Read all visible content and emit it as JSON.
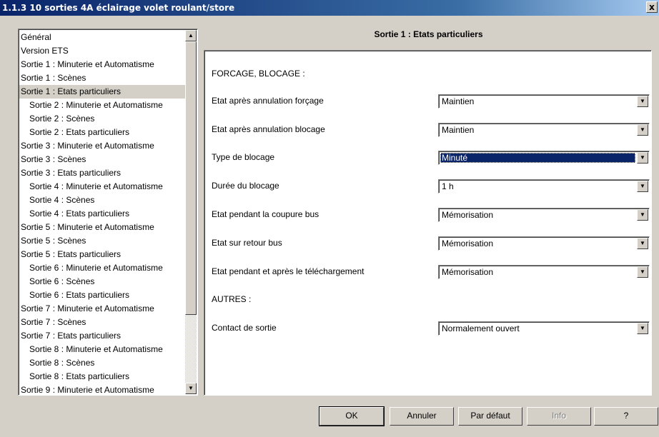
{
  "window": {
    "title": "1.1.3 10 sorties 4A éclairage volet roulant/store",
    "close_label": "x"
  },
  "tree": {
    "items": [
      {
        "label": "Général",
        "level": 1
      },
      {
        "label": "Version ETS",
        "level": 1
      },
      {
        "label": "Sortie 1 : Minuterie et Automatisme",
        "level": 1
      },
      {
        "label": "Sortie 1 : Scènes",
        "level": 1
      },
      {
        "label": "Sortie 1 : Etats particuliers",
        "level": 1,
        "selected": true
      },
      {
        "label": "Sortie 2 : Minuterie et Automatisme",
        "level": 2
      },
      {
        "label": "Sortie 2 : Scènes",
        "level": 2
      },
      {
        "label": "Sortie 2 : Etats particuliers",
        "level": 2
      },
      {
        "label": "Sortie 3 : Minuterie et Automatisme",
        "level": 1
      },
      {
        "label": "Sortie 3 : Scènes",
        "level": 1
      },
      {
        "label": "Sortie 3 : Etats particuliers",
        "level": 1
      },
      {
        "label": "Sortie 4 : Minuterie et Automatisme",
        "level": 2
      },
      {
        "label": "Sortie 4 : Scènes",
        "level": 2
      },
      {
        "label": "Sortie 4 : Etats particuliers",
        "level": 2
      },
      {
        "label": "Sortie 5 : Minuterie et Automatisme",
        "level": 1
      },
      {
        "label": "Sortie 5 : Scènes",
        "level": 1
      },
      {
        "label": "Sortie 5 : Etats particuliers",
        "level": 1
      },
      {
        "label": "Sortie 6 : Minuterie et Automatisme",
        "level": 2
      },
      {
        "label": "Sortie 6 : Scènes",
        "level": 2
      },
      {
        "label": "Sortie 6 : Etats particuliers",
        "level": 2
      },
      {
        "label": "Sortie 7 : Minuterie et Automatisme",
        "level": 1
      },
      {
        "label": "Sortie 7 : Scènes",
        "level": 1
      },
      {
        "label": "Sortie 7 : Etats particuliers",
        "level": 1
      },
      {
        "label": "Sortie 8 : Minuterie et Automatisme",
        "level": 2
      },
      {
        "label": "Sortie 8 : Scènes",
        "level": 2
      },
      {
        "label": "Sortie 8 : Etats particuliers",
        "level": 2
      },
      {
        "label": "Sortie 9 : Minuterie et Automatisme",
        "level": 1
      }
    ],
    "scroll_up_icon": "▲",
    "scroll_down_icon": "▼"
  },
  "panel": {
    "title": "Sortie 1 : Etats particuliers",
    "section1": "FORCAGE, BLOCAGE :",
    "section2": "AUTRES :",
    "params": [
      {
        "label": "Etat après annulation forçage",
        "value": "Maintien"
      },
      {
        "label": "Etat après annulation blocage",
        "value": "Maintien"
      },
      {
        "label": "Type de blocage",
        "value": "Minuté",
        "focused": true
      },
      {
        "label": "Durée du blocage",
        "value": "1 h"
      },
      {
        "label": "Etat pendant la coupure bus",
        "value": "Mémorisation"
      },
      {
        "label": "Etat sur retour bus",
        "value": "Mémorisation"
      },
      {
        "label": "Etat pendant et après le téléchargement",
        "value": "Mémorisation"
      },
      {
        "label": "Contact de sortie",
        "value": "Normalement ouvert"
      }
    ],
    "dropdown_icon": "▼"
  },
  "buttons": {
    "ok": "OK",
    "cancel": "Annuler",
    "default": "Par défaut",
    "info": "Info",
    "help": "?"
  }
}
